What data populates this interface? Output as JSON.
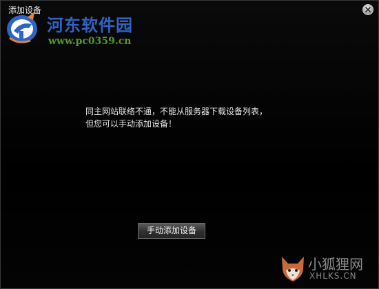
{
  "window": {
    "title": "添加设备"
  },
  "message": {
    "line1": "同主网站联络不通，不能从服务器下载设备列表，",
    "line2": "但您可以手动添加设备！"
  },
  "buttons": {
    "manual_add_label": "手动添加设备"
  },
  "watermark_top": {
    "site_name": "河东软件园",
    "url": "www.pc0359.cn"
  },
  "watermark_bottom": {
    "site_name": "小狐狸网",
    "url": "XHLKS.CN"
  },
  "icons": {
    "close": "close-icon",
    "site_logo": "site-logo-icon",
    "fox_logo": "fox-logo-icon"
  },
  "colors": {
    "background": "#000000",
    "text": "#e6e6e6",
    "watermark_blue": "#2f63c5",
    "watermark_green": "#4e9a2e",
    "watermark_gray": "#8c8c8c"
  }
}
